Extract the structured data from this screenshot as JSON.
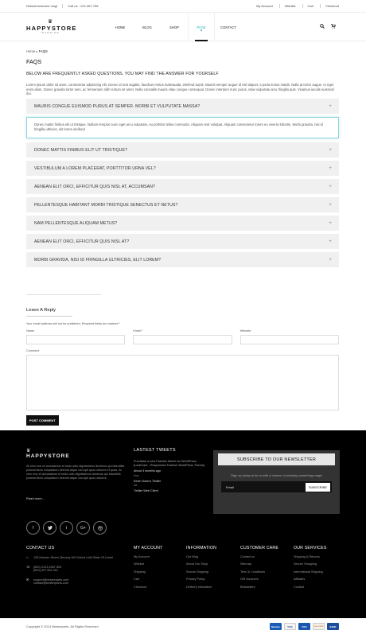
{
  "topbar": {
    "welcome": "Default welcome msg!",
    "phone": "Call us : 124-457-756",
    "links": [
      "My Account",
      "Wishlist",
      "Cart",
      "Checkout"
    ]
  },
  "logo": {
    "crown": "♛",
    "name": "HAPPYSTORE",
    "sub": "INTERIOR"
  },
  "nav": {
    "items": [
      "HOME",
      "BLOG",
      "SHOP",
      "PAGE",
      "CONTACT"
    ],
    "active": "PAGE"
  },
  "header_icons": {
    "search": "search-icon",
    "cart": "cart-icon"
  },
  "breadcrumb": {
    "home": "Home",
    "sep": "▸",
    "current": "FAQS"
  },
  "page": {
    "title": "FAQS",
    "intro_heading": "BELOW ARE FREQUENTLY ASKED QUESTIONS, YOU MAY FIND THE ANSWER FOR YOURSELF",
    "intro_text": "Lorem ipsum dolor sit amet, consectetur adipiscing elit. Donec id erat sagittis, faucibus metus malesuada, eleifend turpis. Mauris semper augue id nisl aliquet, a porta lectus mattis. Nulla at tortor augue. In eget enim diam. Donec gravida tortor sem, ac fermentum nibh rutrum sit amet. Nulla convallis mauris vitae congue consequat. Donec interdum nunc purus, vitae vulputate arcu fringilla quis. Vivamus iaculis euismod dui."
  },
  "faq": {
    "open_question": "MAURIS CONGUE EUISMOD PURUS AT SEMPER. MORBI ET VULPUTATE MASSA?",
    "open_answer": "Donec mattis finibus elit ut tristique. Nullam tempus nunc eget arcu vulputate, eu porttitor tellus commodo. Aliquam erat volutpat. Aliquam consectetur lorem eu viverra lobortis. Morbi gravida, nisi id fringilla ultricies, elit lorem eleifend",
    "questions": [
      "DONEC MATTIS FINIBUS ELIT UT TRISTIQUE?",
      "VESTIBULUM A LOREM PLACERAT, PORTTITOR URNA VEL?",
      "AENEAN ELIT ORCI, EFFICITUR QUIS NISL AT, ACCUMSAN?",
      "PELLENTESQUE HABITANT MORBI TRISTIQUE SENECTUS ET NETUS?",
      "NAM PELLENTESQUE ALIQUAM METUS?",
      "AENEAN ELIT ORCI, EFFICITUR QUIS NISL AT?",
      "MORBI GRAVIDA, NISI ID FRINGILLA ULTRICIES, ELIT LOREM?"
    ],
    "toggle": "+"
  },
  "reply": {
    "title": "Leave A Reply",
    "note": "Your email address will not be published. Required fields are marked *",
    "name_label": "Name",
    "email_label": "Email *",
    "website_label": "Website",
    "comment_label": "Comment",
    "submit": "POST COMMENT"
  },
  "footer": {
    "logo_name": "HAPPYSTORE",
    "about": "At vero eos et accusamus et iusto odio dignissimos ducimus qui blanditiis praesentium voluptatum deleniti atque corrupti quos dolores et quas. At vero eos et accusamus et iusto odio dignissimos ducimus qui blanditiis praesentium voluptatum deleniti atque corrupti quos dolores.",
    "read_more": "Read more...",
    "tweets": {
      "title": "LASTEST TWEETS",
      "tweet": "Purchase a new Fashion theme for WordPress [LookCare - Responsive Fashion WordPress Theme]",
      "ago": "About 3 months ago",
      "from_label": "from",
      "from": "Kevin Sobo's Twitter",
      "via_label": "via",
      "via": "Twitter Web Client"
    },
    "newsletter": {
      "title": "SUBSCRIBE TO OUR NEWSLETTER",
      "text": "Sign up today to be in with a chance of winning something magic",
      "placeholder": "Email",
      "button": "SUBSCRIBE"
    },
    "social": [
      "f",
      "t",
      "t",
      "G+",
      "dribbble"
    ],
    "contact": {
      "title": "CONTACT US",
      "address": "135 Heaven Street, Beverly Hill Oxford Uniti State Of Lionel",
      "phones": "(800) 0123 4567 890\n(800) 097 654 321",
      "emails": "support@bestexparts.com\ncontact@bestexparts.com"
    },
    "columns": [
      {
        "title": "MY ACCOUNT",
        "links": [
          "My Account",
          "Wishlist",
          "Shipping",
          "Cart",
          "Checkout"
        ]
      },
      {
        "title": "INFORMATION",
        "links": [
          "Our Blog",
          "About Our Shop",
          "Secure Shipping",
          "Privacy Policy",
          "Delivery infomation"
        ]
      },
      {
        "title": "CUSTOMER CARE",
        "links": [
          "Contact us",
          "Sitemap",
          "Term & Conditions",
          "Gift Vouchers",
          "Bestsellers"
        ]
      },
      {
        "title": "OUR SERVICES",
        "links": [
          "Shipping & Returns",
          "Secure Shopping",
          "International Shipping",
          "Affiliates",
          "Contact"
        ]
      }
    ]
  },
  "copyright": "Copyright © 2014 Bestexperts. All Rights Reserved",
  "cards": [
    "Maestro",
    "VISA",
    "VISA",
    "DISCOVER",
    "BANK"
  ]
}
